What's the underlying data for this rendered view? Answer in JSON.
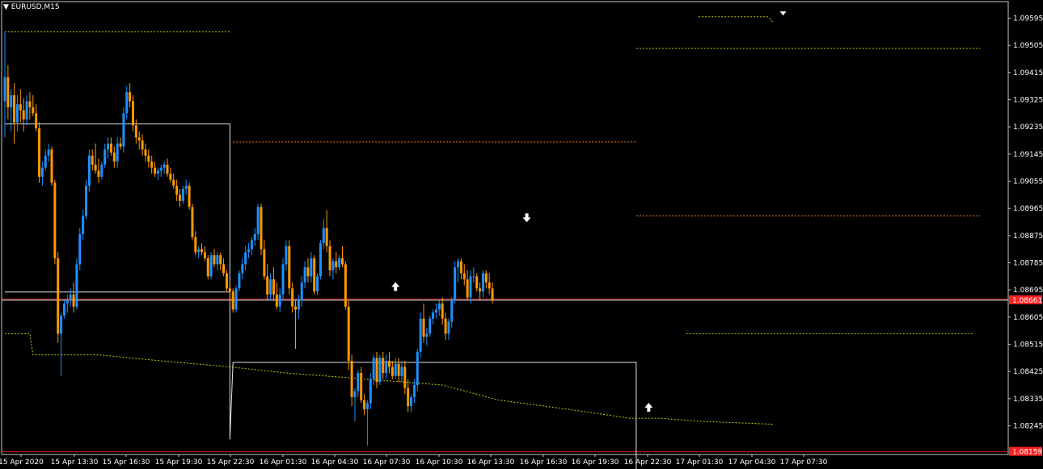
{
  "window": {
    "symbol_label": "EURUSD,M15"
  },
  "colors": {
    "background": "#000000",
    "grid_frame": "#c8c8c8",
    "bull": "#1e90ff",
    "bear": "#ff9800",
    "white_line": "#e6e6e6",
    "level_red": "#cc2222",
    "dotted_orange": "#ff7a1a",
    "dotted_yellow": "#c8c800",
    "price_tag_bg": "#ff2020"
  },
  "chart_data": {
    "type": "candlestick",
    "symbol": "EURUSD",
    "timeframe": "M15",
    "ylim": [
      1.0815,
      1.0965
    ],
    "y_ticks": [
      "1.09595",
      "1.09505",
      "1.09415",
      "1.09325",
      "1.09235",
      "1.09145",
      "1.09055",
      "1.08965",
      "1.08875",
      "1.08785",
      "1.08695",
      "1.08605",
      "1.08515",
      "1.08425",
      "1.08335",
      "1.08245"
    ],
    "x_ticks": [
      "15 Apr 2020",
      "15 Apr 13:30",
      "15 Apr 16:30",
      "15 Apr 19:30",
      "15 Apr 22:30",
      "16 Apr 01:30",
      "16 Apr 04:30",
      "16 Apr 07:30",
      "16 Apr 10:30",
      "16 Apr 13:30",
      "16 Apr 16:30",
      "16 Apr 19:30",
      "16 Apr 22:30",
      "17 Apr 01:30",
      "17 Apr 04:30",
      "17 Apr 07:30"
    ],
    "current_price": "1.08661",
    "lower_level_price": "1.08159",
    "candles": [
      [
        1.0932,
        1.0955,
        1.092,
        1.094
      ],
      [
        1.094,
        1.0944,
        1.0926,
        1.093
      ],
      [
        1.093,
        1.0936,
        1.0922,
        1.0934
      ],
      [
        1.0934,
        1.0938,
        1.0918,
        1.0925
      ],
      [
        1.0925,
        1.0934,
        1.0922,
        1.0931
      ],
      [
        1.0931,
        1.0936,
        1.0925,
        1.0929
      ],
      [
        1.0929,
        1.0933,
        1.0922,
        1.0926
      ],
      [
        1.0926,
        1.0934,
        1.0924,
        1.0932
      ],
      [
        1.0932,
        1.0935,
        1.0926,
        1.093
      ],
      [
        1.093,
        1.0934,
        1.0927,
        1.0928
      ],
      [
        1.0928,
        1.0931,
        1.0922,
        1.0923
      ],
      [
        1.0923,
        1.0925,
        1.0905,
        1.0907
      ],
      [
        1.0907,
        1.0912,
        1.0904,
        1.091
      ],
      [
        1.091,
        1.0916,
        1.0909,
        1.0914
      ],
      [
        1.0914,
        1.0918,
        1.0912,
        1.0916
      ],
      [
        1.0916,
        1.0917,
        1.0904,
        1.0905
      ],
      [
        1.0905,
        1.0906,
        1.0878,
        1.088
      ],
      [
        1.088,
        1.0882,
        1.0852,
        1.0855
      ],
      [
        1.0855,
        1.0862,
        1.0841,
        1.0861
      ],
      [
        1.0861,
        1.0866,
        1.086,
        1.0865
      ],
      [
        1.0865,
        1.0868,
        1.0862,
        1.0866
      ],
      [
        1.0866,
        1.087,
        1.0864,
        1.0868
      ],
      [
        1.0868,
        1.0872,
        1.0862,
        1.0864
      ],
      [
        1.0864,
        1.088,
        1.0863,
        1.0878
      ],
      [
        1.0878,
        1.089,
        1.0876,
        1.0888
      ],
      [
        1.0888,
        1.0896,
        1.0886,
        1.0894
      ],
      [
        1.0894,
        1.0906,
        1.0893,
        1.0904
      ],
      [
        1.0904,
        1.0916,
        1.0902,
        1.0914
      ],
      [
        1.0914,
        1.0916,
        1.0909,
        1.0911
      ],
      [
        1.0911,
        1.0918,
        1.0908,
        1.0909
      ],
      [
        1.0909,
        1.0913,
        1.0905,
        1.0907
      ],
      [
        1.0907,
        1.0912,
        1.0906,
        1.0911
      ],
      [
        1.0911,
        1.0918,
        1.091,
        1.0916
      ],
      [
        1.0916,
        1.092,
        1.0913,
        1.0918
      ],
      [
        1.0918,
        1.092,
        1.0914,
        1.0915
      ],
      [
        1.0915,
        1.0917,
        1.091,
        1.0912
      ],
      [
        1.0912,
        1.092,
        1.091,
        1.0918
      ],
      [
        1.0918,
        1.092,
        1.0916,
        1.0917
      ],
      [
        1.0917,
        1.093,
        1.0915,
        1.0928
      ],
      [
        1.0928,
        1.0937,
        1.0926,
        1.0935
      ],
      [
        1.0935,
        1.0938,
        1.093,
        1.0932
      ],
      [
        1.0932,
        1.0934,
        1.0922,
        1.0924
      ],
      [
        1.0924,
        1.0926,
        1.0918,
        1.092
      ],
      [
        1.092,
        1.0922,
        1.0916,
        1.0919
      ],
      [
        1.0919,
        1.0921,
        1.0914,
        1.0916
      ],
      [
        1.0916,
        1.0918,
        1.0912,
        1.0914
      ],
      [
        1.0914,
        1.0916,
        1.091,
        1.0912
      ],
      [
        1.0912,
        1.0914,
        1.0908,
        1.091
      ],
      [
        1.091,
        1.0912,
        1.0907,
        1.0908
      ],
      [
        1.0908,
        1.091,
        1.0906,
        1.0909
      ],
      [
        1.0909,
        1.0911,
        1.0907,
        1.091
      ],
      [
        1.091,
        1.0912,
        1.0908,
        1.0911
      ],
      [
        1.0911,
        1.0913,
        1.0907,
        1.0908
      ],
      [
        1.0908,
        1.091,
        1.0905,
        1.0906
      ],
      [
        1.0906,
        1.0908,
        1.0903,
        1.0904
      ],
      [
        1.0904,
        1.0906,
        1.0899,
        1.0901
      ],
      [
        1.0901,
        1.0903,
        1.0897,
        1.0899
      ],
      [
        1.0899,
        1.0904,
        1.0898,
        1.0903
      ],
      [
        1.0903,
        1.0906,
        1.0901,
        1.0904
      ],
      [
        1.0904,
        1.0905,
        1.0896,
        1.0897
      ],
      [
        1.0897,
        1.0898,
        1.0886,
        1.0887
      ],
      [
        1.0887,
        1.0889,
        1.0881,
        1.0882
      ],
      [
        1.0882,
        1.0884,
        1.088,
        1.0883
      ],
      [
        1.0883,
        1.0885,
        1.0881,
        1.0882
      ],
      [
        1.0882,
        1.0884,
        1.0879,
        1.088
      ],
      [
        1.088,
        1.0881,
        1.0873,
        1.0874
      ],
      [
        1.0874,
        1.0882,
        1.0873,
        1.0881
      ],
      [
        1.0881,
        1.0883,
        1.0877,
        1.0878
      ],
      [
        1.0878,
        1.0882,
        1.0876,
        1.0881
      ],
      [
        1.0881,
        1.0882,
        1.0876,
        1.0878
      ],
      [
        1.0878,
        1.088,
        1.0874,
        1.0875
      ],
      [
        1.0875,
        1.0876,
        1.0869,
        1.087
      ],
      [
        1.087,
        1.0872,
        1.0866,
        1.0869
      ],
      [
        1.0869,
        1.087,
        1.0862,
        1.0863
      ],
      [
        1.0863,
        1.0871,
        1.0862,
        1.087
      ],
      [
        1.087,
        1.0876,
        1.0869,
        1.0875
      ],
      [
        1.0875,
        1.088,
        1.0873,
        1.0878
      ],
      [
        1.0878,
        1.0884,
        1.0876,
        1.0882
      ],
      [
        1.0882,
        1.0885,
        1.088,
        1.0883
      ],
      [
        1.0883,
        1.0887,
        1.0881,
        1.0886
      ],
      [
        1.0886,
        1.089,
        1.0884,
        1.0888
      ],
      [
        1.0888,
        1.0898,
        1.0886,
        1.0897
      ],
      [
        1.0897,
        1.0898,
        1.0881,
        1.0883
      ],
      [
        1.0883,
        1.0886,
        1.0873,
        1.0874
      ],
      [
        1.0874,
        1.0878,
        1.0866,
        1.0868
      ],
      [
        1.0868,
        1.0875,
        1.0866,
        1.0873
      ],
      [
        1.0873,
        1.0877,
        1.0866,
        1.0868
      ],
      [
        1.0868,
        1.0872,
        1.0863,
        1.0864
      ],
      [
        1.0864,
        1.087,
        1.0862,
        1.0868
      ],
      [
        1.0868,
        1.088,
        1.0866,
        1.0878
      ],
      [
        1.0878,
        1.0886,
        1.0876,
        1.0884
      ],
      [
        1.0884,
        1.0886,
        1.0868,
        1.087
      ],
      [
        1.087,
        1.0872,
        1.0862,
        1.0864
      ],
      [
        1.0864,
        1.0866,
        1.085,
        1.0863
      ],
      [
        1.0863,
        1.0868,
        1.086,
        1.0866
      ],
      [
        1.0866,
        1.0874,
        1.0864,
        1.0872
      ],
      [
        1.0872,
        1.0879,
        1.087,
        1.0877
      ],
      [
        1.0877,
        1.088,
        1.0872,
        1.0874
      ],
      [
        1.0874,
        1.0882,
        1.0872,
        1.088
      ],
      [
        1.088,
        1.0881,
        1.0868,
        1.0869
      ],
      [
        1.0869,
        1.0875,
        1.0868,
        1.0874
      ],
      [
        1.0874,
        1.0886,
        1.0873,
        1.0885
      ],
      [
        1.0885,
        1.0893,
        1.0883,
        1.089
      ],
      [
        1.089,
        1.0896,
        1.0882,
        1.0884
      ],
      [
        1.0884,
        1.0886,
        1.0874,
        1.0876
      ],
      [
        1.0876,
        1.088,
        1.0873,
        1.0879
      ],
      [
        1.0879,
        1.0882,
        1.0875,
        1.0877
      ],
      [
        1.0877,
        1.0881,
        1.0876,
        1.088
      ],
      [
        1.088,
        1.0884,
        1.0877,
        1.0878
      ],
      [
        1.0878,
        1.0879,
        1.0863,
        1.0864
      ],
      [
        1.0864,
        1.0866,
        1.0843,
        1.0846
      ],
      [
        1.0846,
        1.0848,
        1.0831,
        1.0834
      ],
      [
        1.0834,
        1.0837,
        1.0826,
        1.0836
      ],
      [
        1.0836,
        1.0843,
        1.0834,
        1.0842
      ],
      [
        1.0842,
        1.0844,
        1.0832,
        1.0833
      ],
      [
        1.0833,
        1.0835,
        1.0828,
        1.083
      ],
      [
        1.083,
        1.0833,
        1.0818,
        1.0832
      ],
      [
        1.0832,
        1.0842,
        1.083,
        1.084
      ],
      [
        1.084,
        1.0848,
        1.0838,
        1.0847
      ],
      [
        1.0847,
        1.0849,
        1.0837,
        1.0839
      ],
      [
        1.0839,
        1.0848,
        1.0838,
        1.0847
      ],
      [
        1.0847,
        1.0849,
        1.084,
        1.0842
      ],
      [
        1.0842,
        1.0848,
        1.084,
        1.0846
      ],
      [
        1.0846,
        1.0849,
        1.0842,
        1.0844
      ],
      [
        1.0844,
        1.0846,
        1.084,
        1.0841
      ],
      [
        1.0841,
        1.0847,
        1.084,
        1.0845
      ],
      [
        1.0845,
        1.0847,
        1.0839,
        1.0841
      ],
      [
        1.0841,
        1.0846,
        1.0839,
        1.0844
      ],
      [
        1.0844,
        1.0846,
        1.0835,
        1.0837
      ],
      [
        1.0837,
        1.084,
        1.0829,
        1.0831
      ],
      [
        1.0831,
        1.0835,
        1.0829,
        1.0834
      ],
      [
        1.0834,
        1.084,
        1.0832,
        1.0838
      ],
      [
        1.0838,
        1.085,
        1.0836,
        1.0849
      ],
      [
        1.0849,
        1.0862,
        1.0847,
        1.086
      ],
      [
        1.086,
        1.0865,
        1.0852,
        1.0854
      ],
      [
        1.0854,
        1.0857,
        1.0851,
        1.0855
      ],
      [
        1.0855,
        1.0861,
        1.0854,
        1.086
      ],
      [
        1.086,
        1.0863,
        1.0858,
        1.0862
      ],
      [
        1.0862,
        1.0865,
        1.086,
        1.0863
      ],
      [
        1.0863,
        1.0866,
        1.0861,
        1.0865
      ],
      [
        1.0865,
        1.0867,
        1.0858,
        1.086
      ],
      [
        1.086,
        1.0862,
        1.0853,
        1.0855
      ],
      [
        1.0855,
        1.086,
        1.0853,
        1.0859
      ],
      [
        1.0859,
        1.0867,
        1.0857,
        1.0866
      ],
      [
        1.0866,
        1.0879,
        1.0865,
        1.0877
      ],
      [
        1.0877,
        1.088,
        1.0872,
        1.0879
      ],
      [
        1.0879,
        1.088,
        1.0873,
        1.0875
      ],
      [
        1.0875,
        1.0878,
        1.0871,
        1.0873
      ],
      [
        1.0873,
        1.0876,
        1.0866,
        1.0867
      ],
      [
        1.0867,
        1.0876,
        1.0865,
        1.0874
      ],
      [
        1.0874,
        1.0877,
        1.0872,
        1.0874
      ],
      [
        1.0874,
        1.0875,
        1.0869,
        1.087
      ],
      [
        1.087,
        1.0872,
        1.0866,
        1.0869
      ],
      [
        1.0869,
        1.0876,
        1.0867,
        1.0875
      ],
      [
        1.0875,
        1.0876,
        1.087,
        1.0872
      ],
      [
        1.0872,
        1.0875,
        1.0868,
        1.087
      ],
      [
        1.087,
        1.0872,
        1.0865,
        1.0866
      ]
    ],
    "white_line_points": [
      [
        0,
        1.09245
      ],
      [
        72,
        1.09245
      ],
      [
        72,
        1.082
      ],
      [
        73,
        1.08455
      ],
      [
        202,
        1.08455
      ],
      [
        202,
        1.081
      ]
    ],
    "white_box_lower": [
      [
        0,
        1.08688
      ],
      [
        72,
        1.08688
      ]
    ],
    "red_level_1": 1.08665,
    "red_level_2": 1.08159,
    "white_level_current": 1.08661,
    "dotted_orange_levels": [
      {
        "from": 0,
        "to": 72,
        "y": 1.0955
      },
      {
        "from": 73,
        "to": 202,
        "y": 1.09185
      },
      {
        "from": 202,
        "to": 312,
        "y": 1.09495
      },
      {
        "from": 202,
        "to": 312,
        "y": 1.0894
      }
    ],
    "dotted_yellow_lower": [
      [
        0,
        1.0855
      ],
      [
        8,
        1.0855
      ],
      [
        9,
        1.0848
      ],
      [
        30,
        1.0848
      ],
      [
        50,
        1.0846
      ],
      [
        72,
        1.0844
      ],
      [
        90,
        1.0842
      ],
      [
        115,
        1.084
      ],
      [
        140,
        1.0838
      ],
      [
        158,
        1.0833
      ],
      [
        180,
        1.083
      ],
      [
        200,
        1.0827
      ],
      [
        210,
        1.0827
      ],
      [
        222,
        1.0826
      ],
      [
        246,
        1.0825
      ]
    ],
    "dotted_yellow_mid": [
      [
        218,
        1.0855
      ],
      [
        310,
        1.0855
      ]
    ],
    "dotted_yellow_top": [
      [
        222,
        1.096
      ],
      [
        244,
        1.096
      ],
      [
        246,
        1.0958
      ]
    ],
    "arrows": [
      {
        "index": 125,
        "y": 1.08705,
        "dir": "up"
      },
      {
        "index": 167,
        "y": 1.08935,
        "dir": "down"
      },
      {
        "index": 206,
        "y": 1.08305,
        "dir": "up"
      },
      {
        "index": 249,
        "y": 1.09615,
        "dir": "down-small"
      }
    ]
  }
}
